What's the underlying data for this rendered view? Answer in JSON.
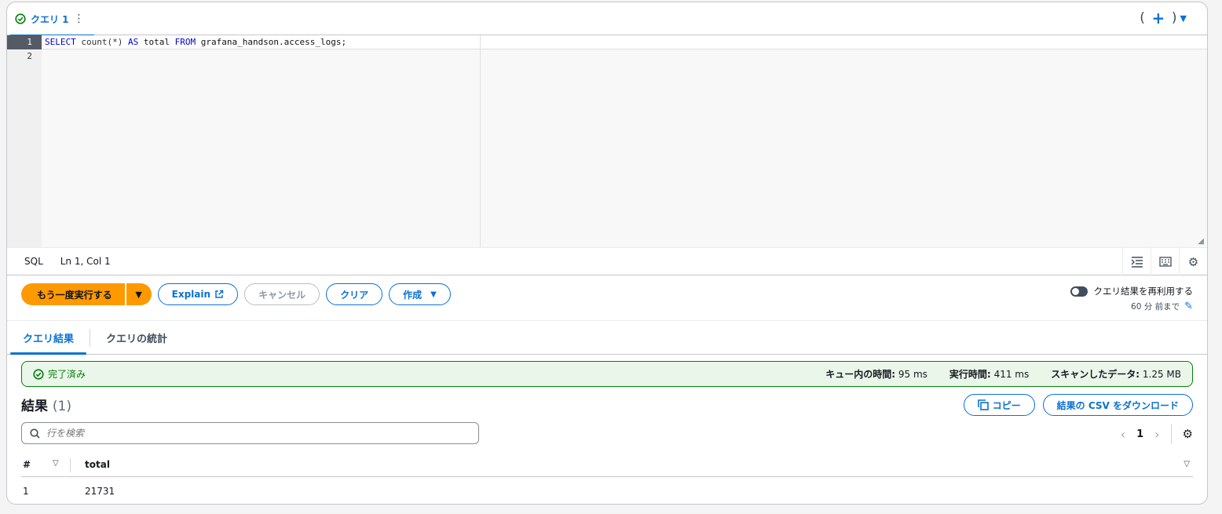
{
  "tab": {
    "label": "クエリ 1",
    "kebab": "⋮"
  },
  "tab_actions": {
    "open_paren": "(",
    "add": "+",
    "close_paren": ")",
    "caret": "▼"
  },
  "editor": {
    "line_numbers": [
      "1",
      "2"
    ],
    "code": {
      "kw_select": "SELECT",
      "fn": " count(*) ",
      "kw_as": "AS",
      "mid": " total ",
      "kw_from": "FROM",
      "rest": " grafana_handson.access_logs;"
    }
  },
  "status": {
    "language": "SQL",
    "position": "Ln 1, Col 1"
  },
  "actions": {
    "run": "もう一度実行する",
    "explain": "Explain",
    "cancel": "キャンセル",
    "clear": "クリア",
    "create": "作成"
  },
  "reuse": {
    "label": "クエリ結果を再利用する",
    "duration": "60 分 前まで"
  },
  "result_tabs": [
    "クエリ結果",
    "クエリの統計"
  ],
  "banner": {
    "status": "完了済み",
    "queue_label": "キュー内の時間:",
    "queue_value": "95 ms",
    "exec_label": "実行時間:",
    "exec_value": "411 ms",
    "scan_label": "スキャンしたデータ:",
    "scan_value": "1.25 MB"
  },
  "results": {
    "title": "結果",
    "count": "(1)",
    "copy": "コピー",
    "download": "結果の CSV をダウンロード",
    "search_placeholder": "行を検索",
    "page": "1",
    "columns": [
      "#",
      "total"
    ],
    "rows": [
      {
        "index": "1",
        "total": "21731"
      }
    ]
  },
  "colors": {
    "accent": "#0972d3",
    "run": "#ff9900",
    "success": "#037f0c"
  }
}
